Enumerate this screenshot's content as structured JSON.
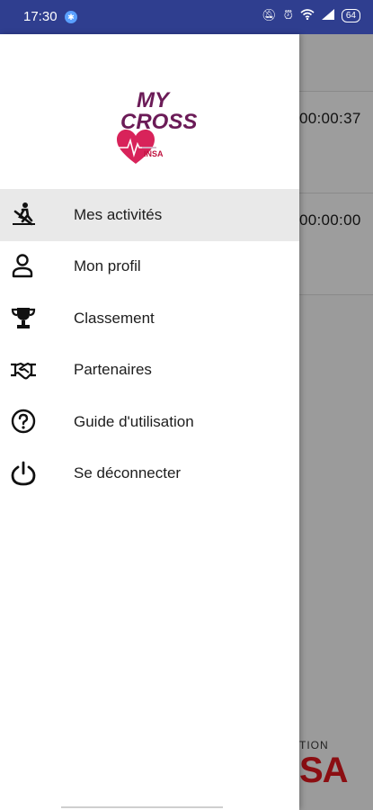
{
  "status_bar": {
    "time": "17:30",
    "battery": "64",
    "icons": [
      "bluetooth-icon",
      "mute-icon",
      "alarm-icon",
      "wifi-icon",
      "signal-icon",
      "battery-icon"
    ]
  },
  "drawer": {
    "logo": {
      "line1": "MY",
      "line2": "CROSS",
      "badge": "INSA"
    },
    "items": [
      {
        "label": "Mes activités",
        "icon": "skiing-icon",
        "active": true
      },
      {
        "label": "Mon profil",
        "icon": "person-icon",
        "active": false
      },
      {
        "label": "Classement",
        "icon": "trophy-icon",
        "active": false
      },
      {
        "label": "Partenaires",
        "icon": "handshake-icon",
        "active": false
      },
      {
        "label": "Guide d'utilisation",
        "icon": "help-circle-icon",
        "active": false
      },
      {
        "label": "Se déconnecter",
        "icon": "power-icon",
        "active": false
      }
    ]
  },
  "background": {
    "activity_times": [
      "00:00:37",
      "00:00:00"
    ],
    "footer_small": "TION",
    "footer_big": "SA"
  },
  "colors": {
    "status_bar": "#2f3e8f",
    "accent": "#6b1b57",
    "active_row": "#e9e9e9",
    "scrim": "#9a9a9a"
  }
}
